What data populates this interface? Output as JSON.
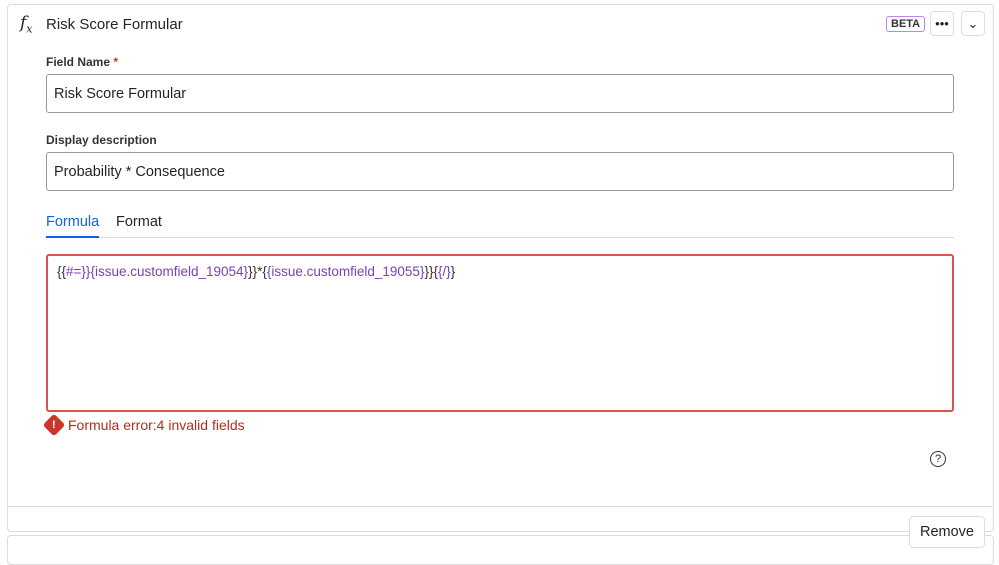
{
  "header": {
    "title": "Risk Score Formular",
    "badge": "BETA",
    "more_icon": "more-icon",
    "collapse_icon": "chevron-down-icon"
  },
  "field_name": {
    "label": "Field Name",
    "required_mark": "*",
    "value": "Risk Score Formular"
  },
  "display_description": {
    "label": "Display description",
    "value": "Probability * Consequence"
  },
  "tabs": [
    {
      "label": "Formula",
      "active": true
    },
    {
      "label": "Format",
      "active": false
    }
  ],
  "formula": {
    "tokens": [
      "{{",
      "#=}}{issue.customfield_19054}",
      "}}*{",
      "{issue.customfield_19055}",
      "}}{",
      "{/}",
      "}"
    ]
  },
  "error": {
    "text": "Formula error:4 invalid fields",
    "color": "#c9372c"
  },
  "footer": {
    "remove_label": "Remove"
  }
}
